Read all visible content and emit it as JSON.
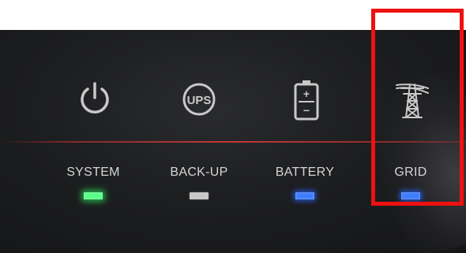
{
  "indicators": [
    {
      "label": "SYSTEM",
      "icon": "power-icon",
      "led_state": "on",
      "led_color": "#5dff8a"
    },
    {
      "label": "BACK-UP",
      "icon": "ups-icon",
      "led_state": "off",
      "led_color": "#c8c8c8"
    },
    {
      "label": "BATTERY",
      "icon": "battery-icon",
      "led_state": "on",
      "led_color": "#3e7dff"
    },
    {
      "label": "GRID",
      "icon": "power-pylon-icon",
      "led_state": "on",
      "led_color": "#3e7dff"
    }
  ],
  "ups_icon_text": "UPS",
  "battery_icon_plus": "+",
  "battery_icon_minus": "−",
  "highlight_color": "#ee1111",
  "highlighted_indicator": "GRID"
}
